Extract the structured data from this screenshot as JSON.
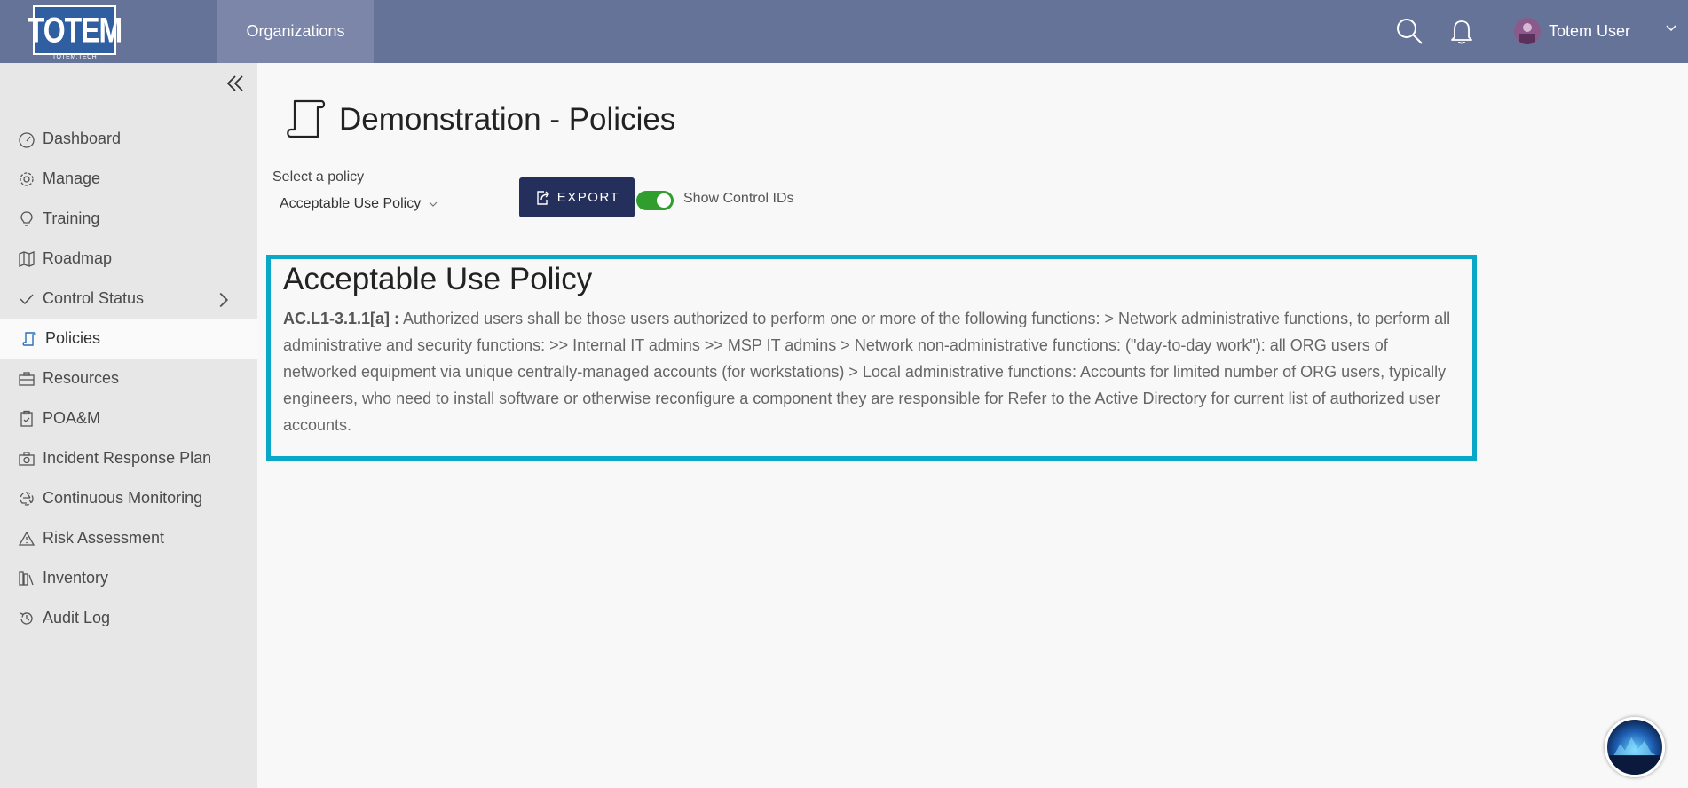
{
  "app": {
    "logo_text": "TOTEM",
    "logo_sub": "TOTEM.TECH",
    "top_tab": "Organizations",
    "user_name": "Totem User"
  },
  "sidebar": {
    "items": [
      {
        "label": "Dashboard",
        "icon": "gauge-icon"
      },
      {
        "label": "Manage",
        "icon": "gear-icon"
      },
      {
        "label": "Training",
        "icon": "lightbulb-icon"
      },
      {
        "label": "Roadmap",
        "icon": "map-icon"
      },
      {
        "label": "Control Status",
        "icon": "check-icon"
      },
      {
        "label": "Policies",
        "icon": "scroll-icon",
        "active": true
      },
      {
        "label": "Resources",
        "icon": "toolbox-icon"
      },
      {
        "label": "POA&M",
        "icon": "clipboard-icon"
      },
      {
        "label": "Incident Response Plan",
        "icon": "camera-icon"
      },
      {
        "label": "Continuous Monitoring",
        "icon": "recycle-icon"
      },
      {
        "label": "Risk Assessment",
        "icon": "warning-icon"
      },
      {
        "label": "Inventory",
        "icon": "books-icon"
      },
      {
        "label": "Audit Log",
        "icon": "history-icon"
      }
    ]
  },
  "main": {
    "title": "Demonstration - Policies",
    "select_label": "Select a policy",
    "select_value": "Acceptable Use Policy",
    "export_label": "EXPORT",
    "toggle_label": "Show Control IDs",
    "toggle_on": true,
    "policy": {
      "title": "Acceptable Use Policy",
      "control_id": "AC.L1-3.1.1[a] :",
      "text": " Authorized users shall be those users authorized to perform one or more of the following functions: > Network administrative functions, to perform all administrative and security functions: >> Internal IT admins >> MSP IT admins > Network non-administrative functions: (\"day-to-day work\"): all ORG users of networked equipment via unique centrally-managed accounts (for workstations) > Local administrative functions: Accounts for limited number of ORG users, typically engineers, who need to install software or otherwise reconfigure a component they are responsible for Refer to the Active Directory for current list of authorized user accounts."
    }
  },
  "colors": {
    "topbar": "#667399",
    "export_button": "#242f5c",
    "toggle_on": "#2f9e2f",
    "policy_border": "#0aa8c8"
  }
}
